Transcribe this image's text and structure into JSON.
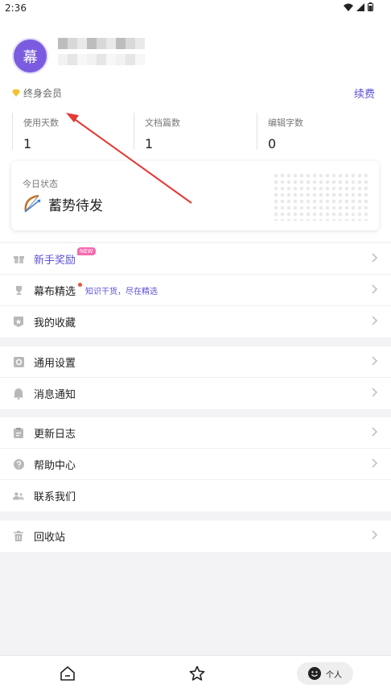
{
  "status_bar": {
    "time": "2:36"
  },
  "profile": {
    "avatar_char": "幕",
    "membership": "终身会员",
    "renew_label": "续费",
    "accent_color": "#5a51d6"
  },
  "stats": [
    {
      "label": "使用天数",
      "value": "1"
    },
    {
      "label": "文档篇数",
      "value": "1"
    },
    {
      "label": "编辑字数",
      "value": "0"
    }
  ],
  "today": {
    "label": "今日状态",
    "status": "蓄势待发"
  },
  "menu": {
    "group1": [
      {
        "label": "新手奖励",
        "badge": "NEW"
      },
      {
        "label": "幕布精选",
        "subtext": "知识干货，尽在精选"
      },
      {
        "label": "我的收藏"
      }
    ],
    "group2": [
      {
        "label": "通用设置"
      },
      {
        "label": "消息通知"
      }
    ],
    "group3": [
      {
        "label": "更新日志"
      },
      {
        "label": "帮助中心"
      },
      {
        "label": "联系我们"
      }
    ],
    "group4": [
      {
        "label": "回收站"
      }
    ]
  },
  "bottom_nav": {
    "items": [
      {
        "icon": "home-icon"
      },
      {
        "icon": "star-icon"
      },
      {
        "icon": "smiley-icon",
        "label": "个人"
      }
    ]
  }
}
